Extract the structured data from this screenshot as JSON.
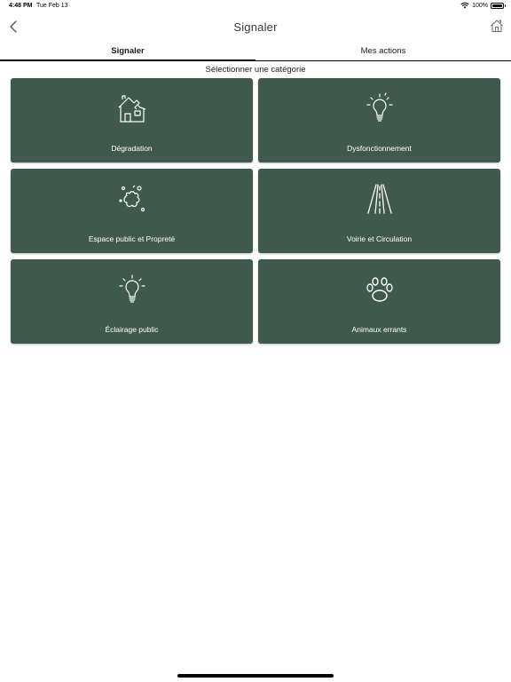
{
  "status_bar": {
    "time": "4:48 PM",
    "date": "Tue Feb 13",
    "battery": "100%",
    "wifi_icon": "wifi-icon",
    "battery_icon": "battery-icon"
  },
  "nav": {
    "title": "Signaler",
    "back_icon": "chevron-left-icon",
    "home_icon": "home-icon"
  },
  "tabs": [
    {
      "label": "Signaler",
      "active": true
    },
    {
      "label": "Mes actions",
      "active": false
    }
  ],
  "section_label": "Sélectionner une catégorie",
  "categories": [
    {
      "label": "Dégradation",
      "icon": "damaged-house-icon"
    },
    {
      "label": "Dysfonctionnement",
      "icon": "lightbulb-icon"
    },
    {
      "label": "Espace public et Propreté",
      "icon": "splash-stain-icon"
    },
    {
      "label": "Voirie et Circulation",
      "icon": "road-icon"
    },
    {
      "label": "Éclairage public",
      "icon": "lightbulb-icon"
    },
    {
      "label": "Animaux errants",
      "icon": "paw-icon"
    }
  ],
  "colors": {
    "tile_background": "#3f5a4c",
    "tile_text": "#ffffff"
  }
}
